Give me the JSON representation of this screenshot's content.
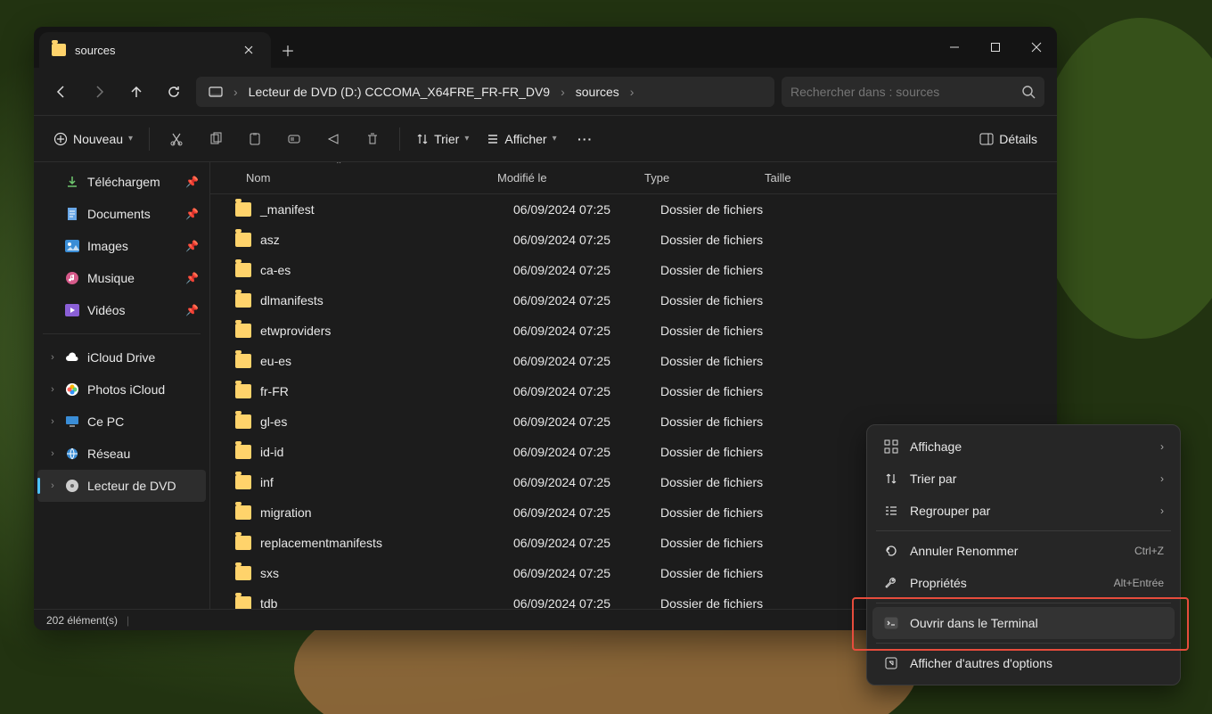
{
  "window": {
    "tab_title": "sources",
    "breadcrumb": {
      "drive": "Lecteur de DVD (D:) CCCOMA_X64FRE_FR-FR_DV9",
      "folder": "sources"
    },
    "search_placeholder": "Rechercher dans : sources",
    "toolbar": {
      "new_label": "Nouveau",
      "sort_label": "Trier",
      "view_label": "Afficher",
      "details_label": "Détails"
    },
    "status": {
      "item_count": "202 élément(s)"
    }
  },
  "sidebar": {
    "quick": [
      {
        "label": "Téléchargem",
        "pinned": true,
        "icon": "download"
      },
      {
        "label": "Documents",
        "pinned": true,
        "icon": "document"
      },
      {
        "label": "Images",
        "pinned": true,
        "icon": "images"
      },
      {
        "label": "Musique",
        "pinned": true,
        "icon": "music"
      },
      {
        "label": "Vidéos",
        "pinned": true,
        "icon": "video"
      }
    ],
    "drives": [
      {
        "label": "iCloud Drive",
        "icon": "icloud"
      },
      {
        "label": "Photos iCloud",
        "icon": "photos"
      },
      {
        "label": "Ce PC",
        "icon": "pc"
      },
      {
        "label": "Réseau",
        "icon": "network"
      },
      {
        "label": "Lecteur de DVD",
        "icon": "dvd",
        "selected": true
      }
    ]
  },
  "columns": {
    "name": "Nom",
    "modified": "Modifié le",
    "type": "Type",
    "size": "Taille"
  },
  "rows": [
    {
      "name": "_manifest",
      "modified": "06/09/2024 07:25",
      "type": "Dossier de fichiers"
    },
    {
      "name": "asz",
      "modified": "06/09/2024 07:25",
      "type": "Dossier de fichiers"
    },
    {
      "name": "ca-es",
      "modified": "06/09/2024 07:25",
      "type": "Dossier de fichiers"
    },
    {
      "name": "dlmanifests",
      "modified": "06/09/2024 07:25",
      "type": "Dossier de fichiers"
    },
    {
      "name": "etwproviders",
      "modified": "06/09/2024 07:25",
      "type": "Dossier de fichiers"
    },
    {
      "name": "eu-es",
      "modified": "06/09/2024 07:25",
      "type": "Dossier de fichiers"
    },
    {
      "name": "fr-FR",
      "modified": "06/09/2024 07:25",
      "type": "Dossier de fichiers"
    },
    {
      "name": "gl-es",
      "modified": "06/09/2024 07:25",
      "type": "Dossier de fichiers"
    },
    {
      "name": "id-id",
      "modified": "06/09/2024 07:25",
      "type": "Dossier de fichiers"
    },
    {
      "name": "inf",
      "modified": "06/09/2024 07:25",
      "type": "Dossier de fichiers"
    },
    {
      "name": "migration",
      "modified": "06/09/2024 07:25",
      "type": "Dossier de fichiers"
    },
    {
      "name": "replacementmanifests",
      "modified": "06/09/2024 07:25",
      "type": "Dossier de fichiers"
    },
    {
      "name": "sxs",
      "modified": "06/09/2024 07:25",
      "type": "Dossier de fichiers"
    },
    {
      "name": "tdb",
      "modified": "06/09/2024 07:25",
      "type": "Dossier de fichiers"
    }
  ],
  "context_menu": {
    "items": [
      {
        "icon": "grid",
        "label": "Affichage",
        "sub": true
      },
      {
        "icon": "sort",
        "label": "Trier par",
        "sub": true
      },
      {
        "icon": "group",
        "label": "Regrouper par",
        "sub": true
      },
      {
        "sep": true
      },
      {
        "icon": "undo",
        "label": "Annuler Renommer",
        "hint": "Ctrl+Z"
      },
      {
        "icon": "wrench",
        "label": "Propriétés",
        "hint": "Alt+Entrée"
      },
      {
        "sep": true
      },
      {
        "icon": "terminal",
        "label": "Ouvrir dans le Terminal",
        "highlighted": true
      },
      {
        "sep": true
      },
      {
        "icon": "more",
        "label": "Afficher d'autres d'options"
      }
    ]
  }
}
